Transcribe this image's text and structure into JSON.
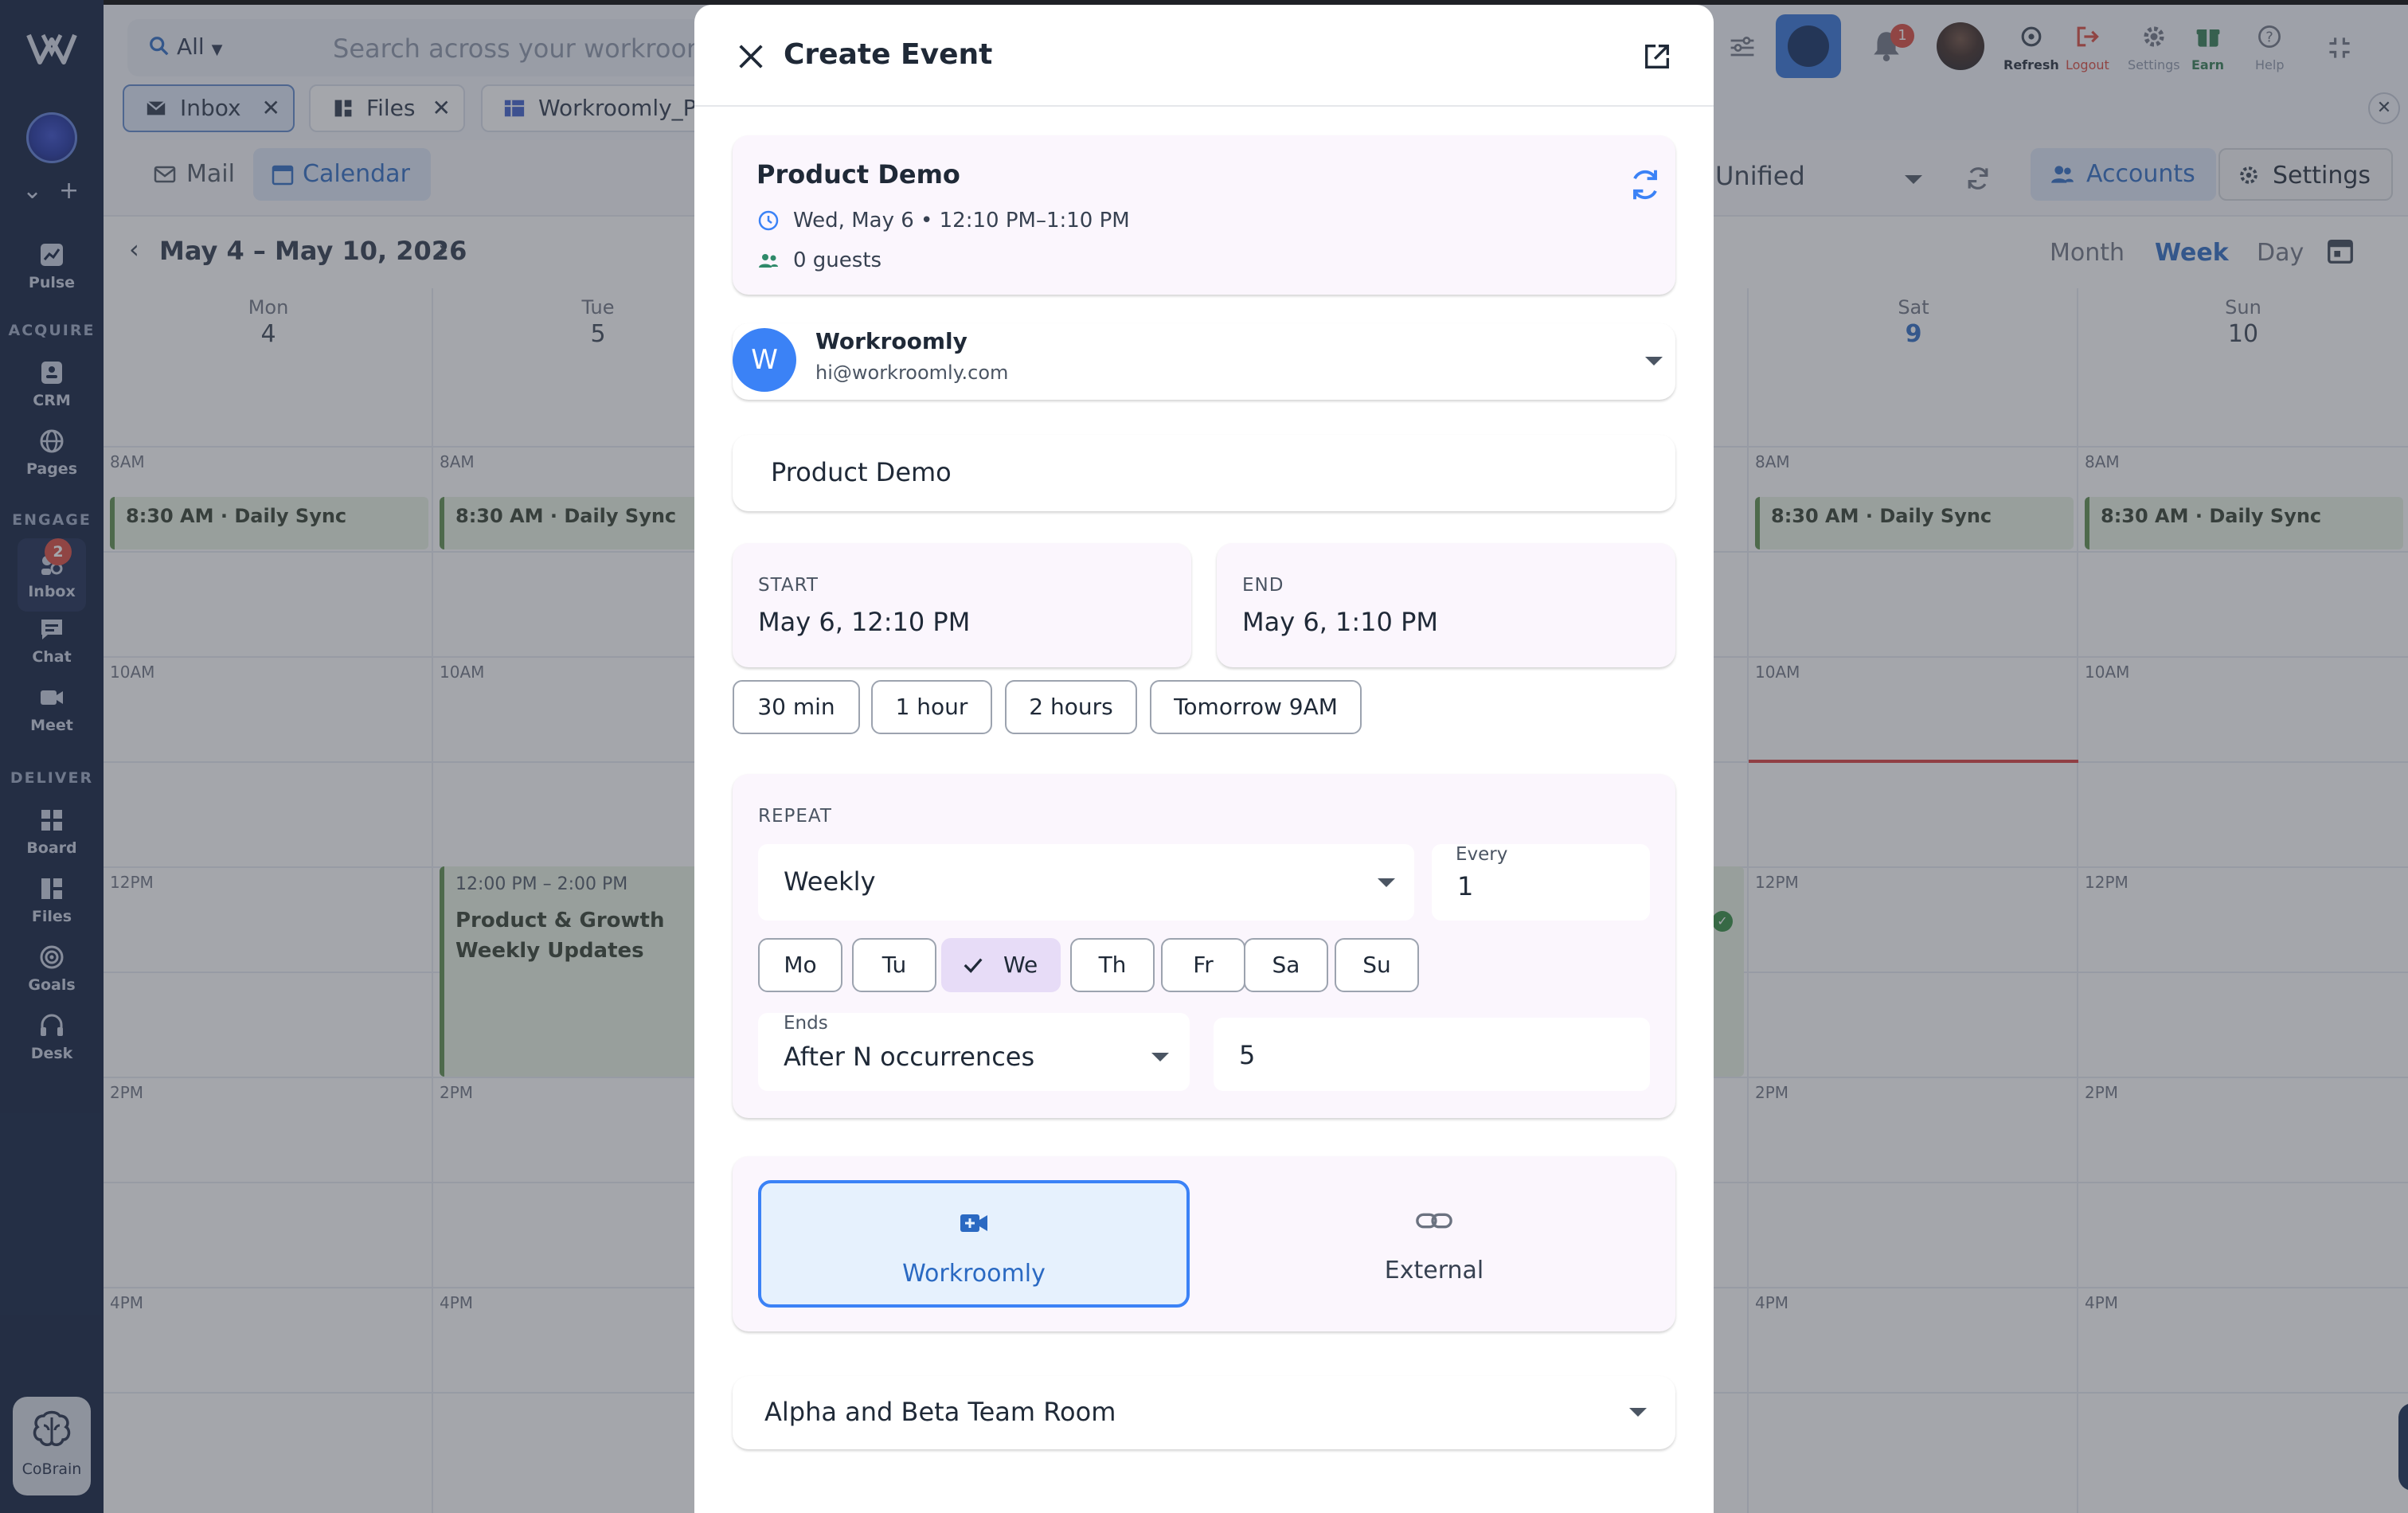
{
  "sidebar": {
    "sections": {
      "acquire": "ACQUIRE",
      "engage": "ENGAGE",
      "deliver": "DELIVER"
    },
    "items": [
      {
        "label": "Pulse",
        "icon": "pulse-icon"
      },
      {
        "label": "CRM",
        "icon": "crm-icon"
      },
      {
        "label": "Pages",
        "icon": "globe-icon"
      },
      {
        "label": "Inbox",
        "icon": "inbox-icon",
        "badge": "2"
      },
      {
        "label": "Chat",
        "icon": "chat-icon"
      },
      {
        "label": "Meet",
        "icon": "video-icon"
      },
      {
        "label": "Board",
        "icon": "board-icon"
      },
      {
        "label": "Files",
        "icon": "files-icon"
      },
      {
        "label": "Goals",
        "icon": "goals-icon"
      },
      {
        "label": "Desk",
        "icon": "headset-icon"
      }
    ],
    "cobrain": "CoBrain"
  },
  "topbar": {
    "scope": "All",
    "search_placeholder": "Search across your workroom...",
    "notification_count": "1",
    "actions": {
      "refresh": "Refresh",
      "logout": "Logout",
      "settings": "Settings",
      "earn": "Earn",
      "help": "Help"
    }
  },
  "tabs": [
    {
      "label": "Inbox"
    },
    {
      "label": "Files"
    },
    {
      "label": "Workroomly_Pro"
    }
  ],
  "subbar": {
    "mail": "Mail",
    "calendar": "Calendar",
    "calendar_select": "Unified",
    "accounts": "Accounts",
    "settings": "Settings"
  },
  "calendar": {
    "range": "May 4 – May 10, 2026",
    "views": {
      "month": "Month",
      "week": "Week",
      "day": "Day"
    },
    "days": [
      {
        "name": "Mon",
        "date": "4"
      },
      {
        "name": "Tue",
        "date": "5"
      },
      {
        "name": "Sat",
        "date": "9"
      },
      {
        "name": "Sun",
        "date": "10"
      }
    ],
    "time_labels": [
      "8AM",
      "10AM",
      "12PM",
      "2PM",
      "4PM"
    ],
    "events": {
      "daily_sync": "8:30 AM · Daily Sync",
      "weekly_time": "12:00 PM – 2:00 PM",
      "weekly_title": "Product & Growth Weekly Updates"
    }
  },
  "modal": {
    "title": "Create Event",
    "summary": {
      "title": "Product Demo",
      "when": "Wed, May 6 • 12:10 PM–1:10 PM",
      "guests": "0 guests"
    },
    "account": {
      "initial": "W",
      "name": "Workroomly",
      "email": "hi@workroomly.com"
    },
    "event_title": "Product Demo",
    "start": {
      "label": "START",
      "value": "May 6, 12:10 PM"
    },
    "end": {
      "label": "END",
      "value": "May 6, 1:10 PM"
    },
    "quick_durations": [
      "30 min",
      "1 hour",
      "2 hours",
      "Tomorrow 9AM"
    ],
    "repeat": {
      "label": "REPEAT",
      "frequency": "Weekly",
      "every_label": "Every",
      "every_value": "1",
      "days": [
        {
          "label": "Mo",
          "selected": false
        },
        {
          "label": "Tu",
          "selected": false
        },
        {
          "label": "We",
          "selected": true
        },
        {
          "label": "Th",
          "selected": false
        },
        {
          "label": "Fr",
          "selected": false
        },
        {
          "label": "Sa",
          "selected": false
        },
        {
          "label": "Su",
          "selected": false
        }
      ],
      "ends_label": "Ends",
      "ends_value": "After N occurrences",
      "occurrences": "5"
    },
    "location": {
      "workroomly": "Workroomly",
      "external": "External",
      "selected": "Workroomly"
    },
    "room": "Alpha and Beta Team Room"
  },
  "colors": {
    "accent": "#2a69c2",
    "rail": "#0b1a3a",
    "modal_card": "#fbf6fd",
    "selected_day": "#e7dcf7",
    "badge": "#d9453b"
  }
}
